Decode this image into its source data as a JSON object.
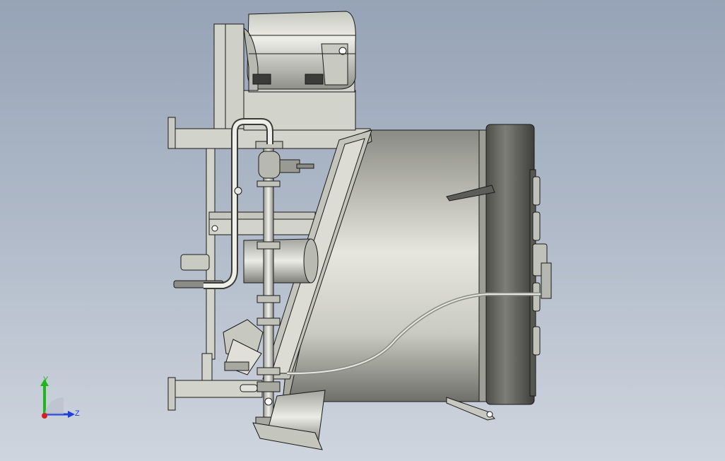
{
  "viewport": {
    "background_top": "#96a3b6",
    "background_bottom": "#cfd5de",
    "model_fill": "#d2d3cb",
    "model_dark": "#5c5d58",
    "edge_color": "#1a1a1a"
  },
  "triad": {
    "y_label": "Y",
    "z_label": "Z",
    "y_color": "#1fb51f",
    "z_color": "#1f3fd8",
    "x_color": "#d81f1f"
  }
}
